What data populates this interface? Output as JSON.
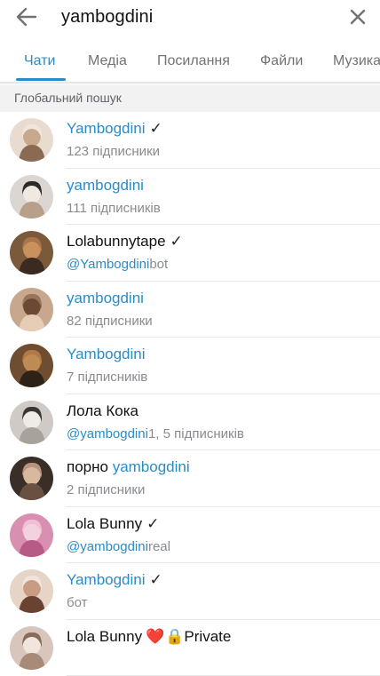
{
  "search": {
    "query": "yambogdini"
  },
  "tabs": [
    {
      "label": "Чати"
    },
    {
      "label": "Медіа"
    },
    {
      "label": "Посилання"
    },
    {
      "label": "Файли"
    },
    {
      "label": "Музика"
    }
  ],
  "section": {
    "title": "Глобальний пошук"
  },
  "results": [
    {
      "title_pre": "",
      "title_hl": "Yambogdini",
      "title_post": "",
      "verified": true,
      "sub_hl": "",
      "sub_post": "123 підписники"
    },
    {
      "title_pre": "",
      "title_hl": "yambogdini",
      "title_post": "",
      "verified": false,
      "sub_hl": "",
      "sub_post": "111 підписників"
    },
    {
      "title_pre": "Lolabunnytape",
      "title_hl": "",
      "title_post": "",
      "verified": true,
      "sub_hl": "@Yambogdini",
      "sub_post": "bot"
    },
    {
      "title_pre": "",
      "title_hl": "yambogdini",
      "title_post": "",
      "verified": false,
      "sub_hl": "",
      "sub_post": "82 підписники"
    },
    {
      "title_pre": "",
      "title_hl": "Yambogdini",
      "title_post": "",
      "verified": false,
      "sub_hl": "",
      "sub_post": "7 підписників"
    },
    {
      "title_pre": "Лола Кока",
      "title_hl": "",
      "title_post": "",
      "verified": false,
      "sub_hl": "@yambogdini",
      "sub_post": "1, 5 підписників"
    },
    {
      "title_pre": "порно ",
      "title_hl": "yambogdini",
      "title_post": "",
      "verified": false,
      "sub_hl": "",
      "sub_post": "2 підписники"
    },
    {
      "title_pre": "Lola Bunny",
      "title_hl": "",
      "title_post": "",
      "verified": true,
      "sub_hl": "@yambogdini",
      "sub_post": "real"
    },
    {
      "title_pre": "",
      "title_hl": "Yambogdini",
      "title_post": "",
      "verified": true,
      "sub_hl": "",
      "sub_post": "бот"
    },
    {
      "title_pre": "Lola Bunny",
      "title_hl": "",
      "title_post": "Private",
      "verified": false,
      "heart": "❤️",
      "lock": "🔒",
      "sub_hl": "",
      "sub_post": ""
    }
  ],
  "verified_mark": "✓",
  "colors": {
    "accent": "#2a8cc7",
    "secondary_text": "#888c90",
    "section_bg": "#f2f2f2"
  },
  "icons": {
    "back": "arrow-left-icon",
    "close": "close-icon"
  }
}
